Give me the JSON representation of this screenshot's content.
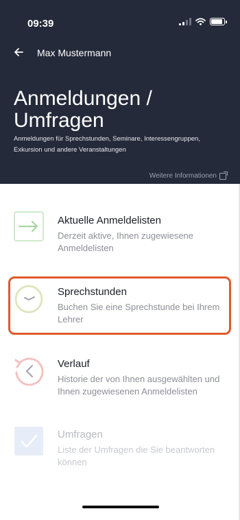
{
  "status_bar": {
    "time": "09:39",
    "icons": [
      "signal-icon",
      "wifi-icon",
      "battery-icon"
    ]
  },
  "nav": {
    "back_icon": "arrow-left-icon",
    "user_name": "Max Mustermann"
  },
  "header": {
    "title_line1": "Anmeldungen /",
    "title_line2": "Umfragen",
    "subtitle": "Anmeldungen für Sprechstunden, Seminare, Interessengruppen, Exkursion und andere Veranstaltungen",
    "more_link": "Weitere Informationen",
    "more_link_icon": "external-link-icon",
    "background_color": "#252a3a"
  },
  "items": [
    {
      "title": "Aktuelle Anmeldelisten",
      "description": "Derzeit aktive, Ihnen zugewiesene Anmeldelisten",
      "icon": "arrow-right-icon",
      "icon_color": "#a8d5a2"
    },
    {
      "title": "Sprechstunden",
      "description": "Buchen Sie eine Sprechstunde bei Ihrem Lehrer",
      "icon": "clock-icon",
      "icon_color": "#d9e2b4"
    },
    {
      "title": "Verlauf",
      "description": "Historie der von Ihnen ausgewählten und Ihnen zugewiesenen Anmeldelisten",
      "icon": "history-icon",
      "icon_color": "#f0b8b8"
    },
    {
      "title": "Umfragen",
      "description": "Liste der Umfragen die Sie beantworten können",
      "icon": "checkbox-icon",
      "icon_color": "#c8d6ef"
    }
  ],
  "highlight_color": "#e0592c"
}
